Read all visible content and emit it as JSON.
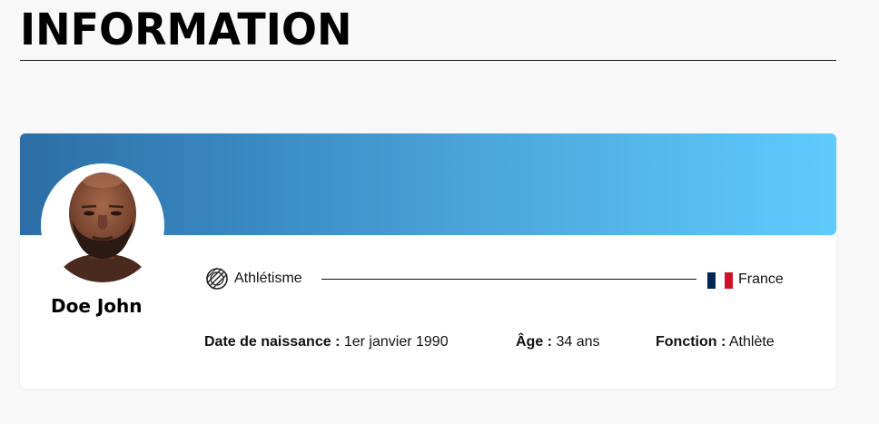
{
  "header": {
    "title": "INFORMATION"
  },
  "profile": {
    "name": "Doe John",
    "sport": "Athlétisme",
    "sport_icon": "athletics-icon",
    "country": "France",
    "country_icon": "france-flag-icon",
    "flag_colors": [
      "#002654",
      "#ffffff",
      "#ce1126"
    ],
    "banner_colors": [
      "#2d6ea6",
      "#5fcbff"
    ]
  },
  "details": {
    "birth_label": "Date de naissance :",
    "birth_value": "1er janvier 1990",
    "age_label": "Âge :",
    "age_value": "34 ans",
    "role_label": "Fonction :",
    "role_value": "Athlète"
  }
}
